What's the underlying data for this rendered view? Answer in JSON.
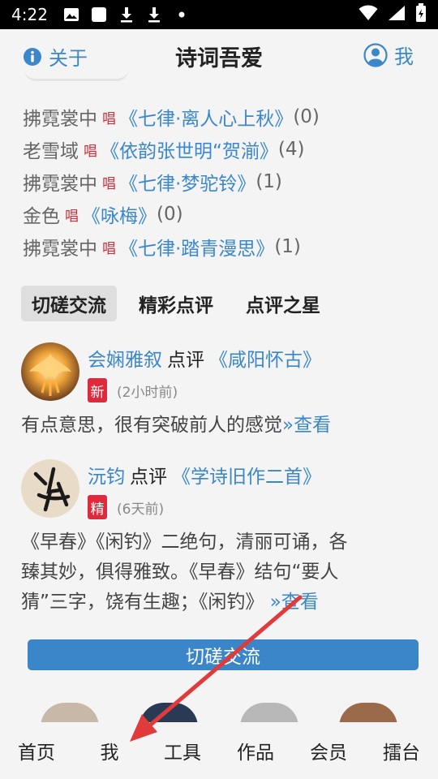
{
  "status_bar": {
    "time": "4:22",
    "icons": [
      "image-icon",
      "square-icon",
      "download-icon",
      "download-icon",
      "dot-icon"
    ],
    "right_icons": [
      "wifi-icon",
      "signal-icon",
      "battery-icon"
    ]
  },
  "header": {
    "about_label": "关于",
    "title": "诗词吾爱",
    "me_label": "我"
  },
  "chants": [
    {
      "author": "拂霓裳中",
      "tag": "唱",
      "work": "《七律·离人心上秋》",
      "count": "(0)"
    },
    {
      "author": "老雪域",
      "tag": "唱",
      "work": "《依韵张世明“贺湔》",
      "count": "(4)"
    },
    {
      "author": "拂霓裳中",
      "tag": "唱",
      "work": "《七律·梦驼铃》",
      "count": "(1)"
    },
    {
      "author": "金色",
      "tag": "唱",
      "work": "《咏梅》",
      "count": "(0)"
    },
    {
      "author": "拂霓裳中",
      "tag": "唱",
      "work": "《七律·踏青漫思》",
      "count": "(1)"
    }
  ],
  "tabs": [
    {
      "label": "切磋交流",
      "active": true
    },
    {
      "label": "精彩点评",
      "active": false
    },
    {
      "label": "点评之星",
      "active": false
    }
  ],
  "comments": [
    {
      "user": "会娴雅叙",
      "verb": "点评",
      "work": "《咸阳怀古》",
      "badge": "新",
      "time": "(2小时前)",
      "text": "有点意思，很有突破前人的感觉",
      "more": "»查看"
    },
    {
      "user": "沅钧",
      "verb": "点评",
      "work": "《学诗旧作二首》",
      "badge": "精",
      "time": "(6天前)",
      "text_lines": [
        "《早春》《闲钓》二绝句，清丽可诵，各",
        "臻其妙，俱得雅致。《早春》结句“要人",
        "猜”三字，饶有生趣；《闲钓》"
      ],
      "more": "»查看"
    }
  ],
  "section_button": "切磋交流",
  "bottom_nav": [
    "首页",
    "我",
    "工具",
    "作品",
    "会员",
    "擂台"
  ],
  "colors": {
    "link": "#3b87c9",
    "chang_tag": "#d0303a",
    "badge": "#dd2b3d",
    "button": "#3a86c8",
    "arrow": "#e03a3a"
  }
}
